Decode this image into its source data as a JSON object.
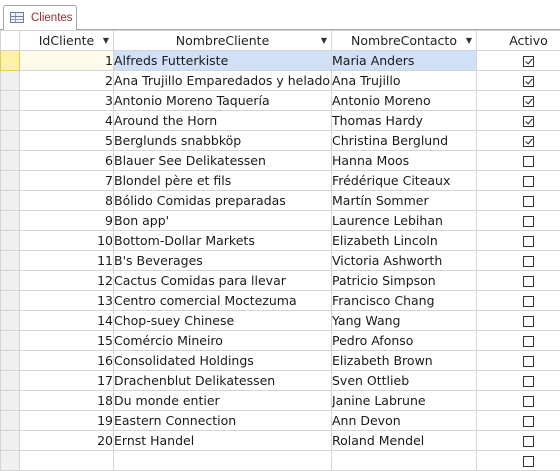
{
  "tab": {
    "label": "Clientes",
    "icon": "table-icon"
  },
  "columns": [
    {
      "label": "IdCliente",
      "sort": "ascending"
    },
    {
      "label": "NombreCliente",
      "sort": "none"
    },
    {
      "label": "NombreContacto",
      "sort": "none"
    },
    {
      "label": "Activo",
      "sort": "none"
    }
  ],
  "current_row": 0,
  "rows": [
    {
      "id": "1",
      "name": "Alfreds Futterkiste",
      "contact": "Maria Anders",
      "active": true
    },
    {
      "id": "2",
      "name": "Ana Trujillo Emparedados y helados",
      "contact": "Ana Trujillo",
      "active": true
    },
    {
      "id": "3",
      "name": "Antonio Moreno Taquería",
      "contact": "Antonio Moreno",
      "active": true
    },
    {
      "id": "4",
      "name": "Around the Horn",
      "contact": "Thomas Hardy",
      "active": true
    },
    {
      "id": "5",
      "name": "Berglunds snabbköp",
      "contact": "Christina Berglund",
      "active": true
    },
    {
      "id": "6",
      "name": "Blauer See Delikatessen",
      "contact": "Hanna Moos",
      "active": false
    },
    {
      "id": "7",
      "name": "Blondel père et fils",
      "contact": "Frédérique Citeaux",
      "active": false
    },
    {
      "id": "8",
      "name": "Bólido Comidas preparadas",
      "contact": "Martín Sommer",
      "active": false
    },
    {
      "id": "9",
      "name": "Bon app'",
      "contact": "Laurence Lebihan",
      "active": false
    },
    {
      "id": "10",
      "name": "Bottom-Dollar Markets",
      "contact": "Elizabeth Lincoln",
      "active": false
    },
    {
      "id": "11",
      "name": "B's Beverages",
      "contact": "Victoria Ashworth",
      "active": false
    },
    {
      "id": "12",
      "name": "Cactus Comidas para llevar",
      "contact": "Patricio Simpson",
      "active": false
    },
    {
      "id": "13",
      "name": "Centro comercial Moctezuma",
      "contact": "Francisco Chang",
      "active": false
    },
    {
      "id": "14",
      "name": "Chop-suey Chinese",
      "contact": "Yang Wang",
      "active": false
    },
    {
      "id": "15",
      "name": "Comércio Mineiro",
      "contact": "Pedro Afonso",
      "active": false
    },
    {
      "id": "16",
      "name": "Consolidated Holdings",
      "contact": "Elizabeth Brown",
      "active": false
    },
    {
      "id": "17",
      "name": "Drachenblut Delikatessen",
      "contact": "Sven Ottlieb",
      "active": false
    },
    {
      "id": "18",
      "name": "Du monde entier",
      "contact": "Janine Labrune",
      "active": false
    },
    {
      "id": "19",
      "name": "Eastern Connection",
      "contact": "Ann Devon",
      "active": false
    },
    {
      "id": "20",
      "name": "Ernst Handel",
      "contact": "Roland Mendel",
      "active": false
    },
    {
      "id": "",
      "name": "",
      "contact": "",
      "active": false
    }
  ]
}
